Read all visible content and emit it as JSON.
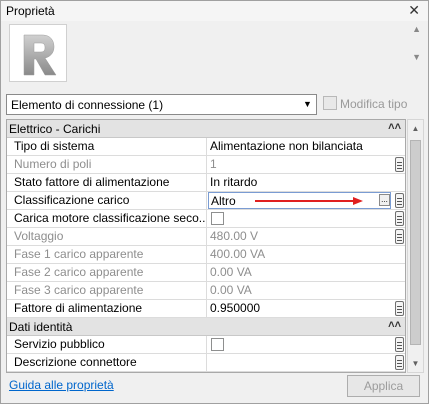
{
  "window": {
    "title": "Proprietà",
    "close_label": "✕"
  },
  "type_selector": {
    "logo_letter": "R"
  },
  "instance": {
    "selected": "Elemento di connessione (1)",
    "edit_type_label": "Modifica tipo"
  },
  "groups": [
    {
      "label": "Elettrico - Carichi",
      "rows": [
        {
          "name": "Tipo di sistema",
          "value": "Alimentazione non bilanciata",
          "disabled": false
        },
        {
          "name": "Numero di poli",
          "value": "1",
          "disabled": true
        },
        {
          "name": "Stato fattore di alimentazione",
          "value": "In ritardo",
          "disabled": false
        },
        {
          "name": "Classificazione carico",
          "value": "Altro",
          "disabled": false
        },
        {
          "name": "Carica motore classificazione seco...",
          "value": "",
          "disabled": false
        },
        {
          "name": "Voltaggio",
          "value": "480.00 V",
          "disabled": true
        },
        {
          "name": "Fase 1 carico apparente",
          "value": "400.00 VA",
          "disabled": true
        },
        {
          "name": "Fase 2 carico apparente",
          "value": "0.00 VA",
          "disabled": true
        },
        {
          "name": "Fase 3 carico apparente",
          "value": "0.00 VA",
          "disabled": true
        },
        {
          "name": "Fattore di alimentazione",
          "value": "0.950000",
          "disabled": false
        }
      ]
    },
    {
      "label": "Dati identità",
      "rows": [
        {
          "name": "Servizio pubblico",
          "value": "",
          "disabled": false
        },
        {
          "name": "Descrizione connettore",
          "value": "",
          "disabled": false
        }
      ]
    }
  ],
  "footer": {
    "help_link": "Guida alle proprietà",
    "apply_label": "Applica"
  },
  "colors": {
    "link": "#0066cc",
    "annotation_arrow": "#e02020",
    "group_header": "#e3e3e3"
  }
}
